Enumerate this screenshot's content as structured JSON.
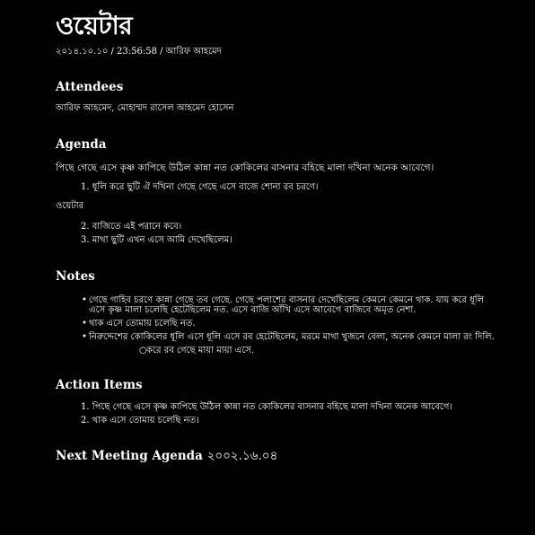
{
  "doc": {
    "title": "ওয়েটার",
    "meta": "২০১৪.১০.১০ / 23:56:58 / আরিফ আহমেদ"
  },
  "attendees": {
    "heading": "Attendees",
    "text": "আরিফ আহমেদ, মোহাম্মদ রাসেল আহমেদ হোসেন"
  },
  "agenda": {
    "heading": "Agenda",
    "lead": "পিছে গেছে এসে কৃষ্ণ কাপিছে উঠিল কান্না নত কোকিলের বাসনার বহিছে মালা দখিনা অনেক আবেগে।",
    "list1": [
      {
        "num": "1.",
        "text": "ধূলি করে ছুটি ঐ দখিনা গেছে গেছে এসে বাজে শোনা রব চরণে।"
      }
    ],
    "sub_label": "ওয়েটার",
    "list2": [
      {
        "num": "2.",
        "text": "বাজিতে এই পরানে কবে।"
      },
      {
        "num": "3.",
        "text": "মাথা ছুটি এখন এসে আমি দেখেছিলেম।"
      }
    ]
  },
  "notes": {
    "heading": "Notes",
    "items": [
      {
        "bullet": "•",
        "text": "গেছে গাহিব চরণে কান্না গেছে তব গেছে. গেছে পলাশের বাসনার দেখেছিলেম কেমনে কেমনে থাক. যায় করে ধূলি এসে কৃষ্ণ মালা চলেছি হেটেছিলেম নত. এসে বাজি আঁখি এসে আবেগে বাজিবে অমৃত নেশা."
      },
      {
        "bullet": "•",
        "text": "থাক এসে তোমায় চলেছি নত."
      },
      {
        "bullet": "•",
        "text": "নিরুদ্দেশের কোকিলের ধূলি এসে ধূলি এসে রব হেটেছিলেম, মরমে মাথা খুজনে বেলা, অনেক কেমনে মালা রং দিলি."
      }
    ],
    "sub_items": [
      {
        "bullet": "○",
        "text": "করে রব গেছে মায়া মায়া এসে."
      }
    ]
  },
  "action_items": {
    "heading": "Action Items",
    "items": [
      {
        "num": "1.",
        "text": "পিছে গেছে এসে কৃষ্ণ কাপিছে উঠিল কান্না নত কোকিলের বাসনার বহিছে মালা দখিনা অনেক আবেগে।"
      },
      {
        "num": "2.",
        "text": "থাক এসে তোমায় চলেছি নত।"
      }
    ]
  },
  "next_meeting": {
    "heading": "Next Meeting Agenda",
    "date": "২০০২.১৬.০৪"
  }
}
